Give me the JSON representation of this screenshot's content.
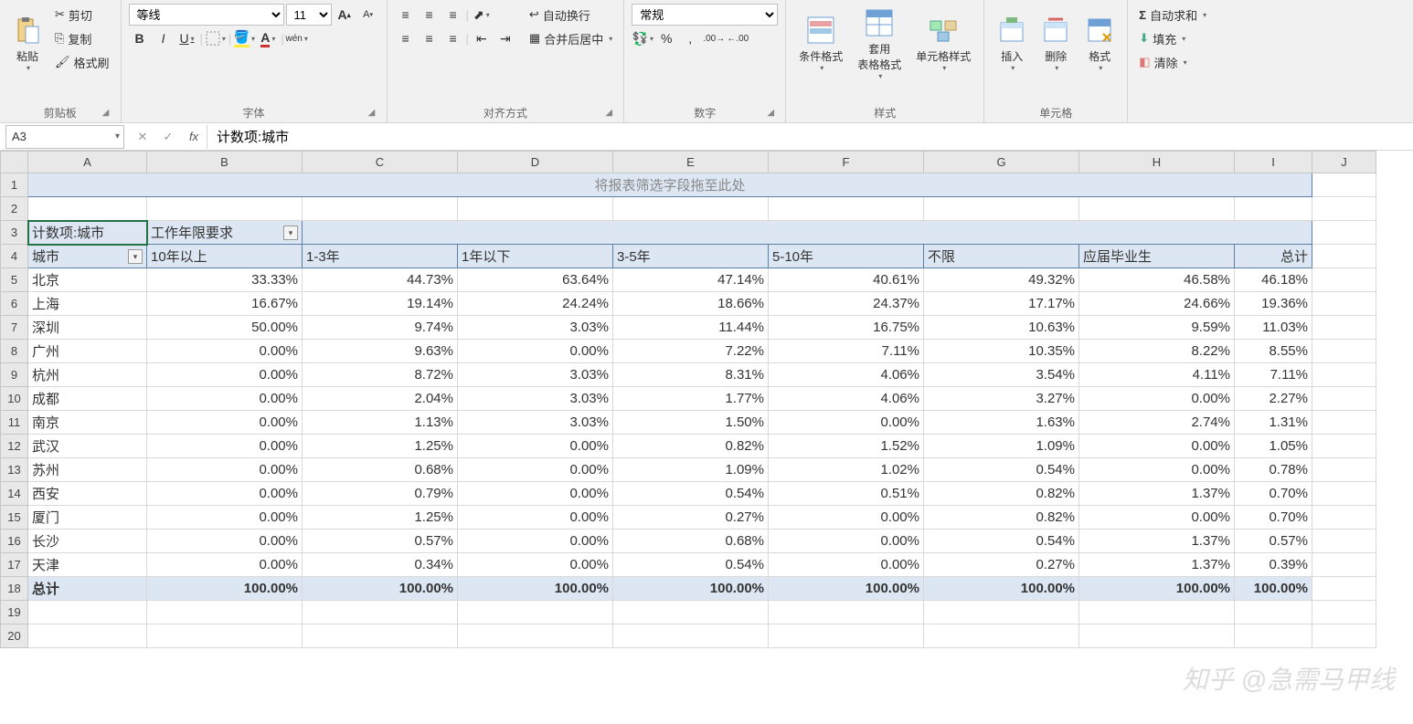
{
  "ribbon": {
    "clipboard": {
      "label": "剪贴板",
      "paste": "粘贴",
      "cut": "剪切",
      "copy": "复制",
      "format_painter": "格式刷"
    },
    "font": {
      "label": "字体",
      "name": "等线",
      "size": "11",
      "bold": "B",
      "italic": "I",
      "underline": "U",
      "pinyin": "wén"
    },
    "align": {
      "label": "对齐方式",
      "wrap": "自动换行",
      "merge": "合并后居中"
    },
    "number": {
      "label": "数字",
      "format": "常规"
    },
    "styles": {
      "label": "样式",
      "conditional": "条件格式",
      "table": "套用\n表格格式",
      "cell": "单元格样式"
    },
    "cells": {
      "label": "单元格",
      "insert": "插入",
      "delete": "删除",
      "format": "格式"
    },
    "editing": {
      "autosum": "自动求和",
      "fill": "填充",
      "clear": "清除"
    }
  },
  "formula_bar": {
    "cell_ref": "A3",
    "formula": "计数项:城市"
  },
  "columns": [
    "A",
    "B",
    "C",
    "D",
    "E",
    "F",
    "G",
    "H",
    "I",
    "J"
  ],
  "pivot": {
    "placeholder": "将报表筛选字段拖至此处",
    "value_field": "计数项:城市",
    "col_field": "工作年限要求",
    "row_field": "城市",
    "col_headers": [
      "10年以上",
      "1-3年",
      "1年以下",
      "3-5年",
      "5-10年",
      "不限",
      "应届毕业生",
      "总计"
    ],
    "rows": [
      {
        "label": "北京",
        "v": [
          "33.33%",
          "44.73%",
          "63.64%",
          "47.14%",
          "40.61%",
          "49.32%",
          "46.58%",
          "46.18%"
        ]
      },
      {
        "label": "上海",
        "v": [
          "16.67%",
          "19.14%",
          "24.24%",
          "18.66%",
          "24.37%",
          "17.17%",
          "24.66%",
          "19.36%"
        ]
      },
      {
        "label": "深圳",
        "v": [
          "50.00%",
          "9.74%",
          "3.03%",
          "11.44%",
          "16.75%",
          "10.63%",
          "9.59%",
          "11.03%"
        ]
      },
      {
        "label": "广州",
        "v": [
          "0.00%",
          "9.63%",
          "0.00%",
          "7.22%",
          "7.11%",
          "10.35%",
          "8.22%",
          "8.55%"
        ]
      },
      {
        "label": "杭州",
        "v": [
          "0.00%",
          "8.72%",
          "3.03%",
          "8.31%",
          "4.06%",
          "3.54%",
          "4.11%",
          "7.11%"
        ]
      },
      {
        "label": "成都",
        "v": [
          "0.00%",
          "2.04%",
          "3.03%",
          "1.77%",
          "4.06%",
          "3.27%",
          "0.00%",
          "2.27%"
        ]
      },
      {
        "label": "南京",
        "v": [
          "0.00%",
          "1.13%",
          "3.03%",
          "1.50%",
          "0.00%",
          "1.63%",
          "2.74%",
          "1.31%"
        ]
      },
      {
        "label": "武汉",
        "v": [
          "0.00%",
          "1.25%",
          "0.00%",
          "0.82%",
          "1.52%",
          "1.09%",
          "0.00%",
          "1.05%"
        ]
      },
      {
        "label": "苏州",
        "v": [
          "0.00%",
          "0.68%",
          "0.00%",
          "1.09%",
          "1.02%",
          "0.54%",
          "0.00%",
          "0.78%"
        ]
      },
      {
        "label": "西安",
        "v": [
          "0.00%",
          "0.79%",
          "0.00%",
          "0.54%",
          "0.51%",
          "0.82%",
          "1.37%",
          "0.70%"
        ]
      },
      {
        "label": "厦门",
        "v": [
          "0.00%",
          "1.25%",
          "0.00%",
          "0.27%",
          "0.00%",
          "0.82%",
          "0.00%",
          "0.70%"
        ]
      },
      {
        "label": "长沙",
        "v": [
          "0.00%",
          "0.57%",
          "0.00%",
          "0.68%",
          "0.00%",
          "0.54%",
          "1.37%",
          "0.57%"
        ]
      },
      {
        "label": "天津",
        "v": [
          "0.00%",
          "0.34%",
          "0.00%",
          "0.54%",
          "0.00%",
          "0.27%",
          "1.37%",
          "0.39%"
        ]
      }
    ],
    "total_label": "总计",
    "total_values": [
      "100.00%",
      "100.00%",
      "100.00%",
      "100.00%",
      "100.00%",
      "100.00%",
      "100.00%",
      "100.00%"
    ]
  },
  "watermark": "知乎 @急需马甲线",
  "chart_data": {
    "type": "table",
    "title": "计数项:城市 按 工作年限要求",
    "row_dimension": "城市",
    "col_dimension": "工作年限要求",
    "columns": [
      "10年以上",
      "1-3年",
      "1年以下",
      "3-5年",
      "5-10年",
      "不限",
      "应届毕业生",
      "总计"
    ],
    "rows": [
      "北京",
      "上海",
      "深圳",
      "广州",
      "杭州",
      "成都",
      "南京",
      "武汉",
      "苏州",
      "西安",
      "厦门",
      "长沙",
      "天津",
      "总计"
    ],
    "values_percent": [
      [
        33.33,
        44.73,
        63.64,
        47.14,
        40.61,
        49.32,
        46.58,
        46.18
      ],
      [
        16.67,
        19.14,
        24.24,
        18.66,
        24.37,
        17.17,
        24.66,
        19.36
      ],
      [
        50.0,
        9.74,
        3.03,
        11.44,
        16.75,
        10.63,
        9.59,
        11.03
      ],
      [
        0.0,
        9.63,
        0.0,
        7.22,
        7.11,
        10.35,
        8.22,
        8.55
      ],
      [
        0.0,
        8.72,
        3.03,
        8.31,
        4.06,
        3.54,
        4.11,
        7.11
      ],
      [
        0.0,
        2.04,
        3.03,
        1.77,
        4.06,
        3.27,
        0.0,
        2.27
      ],
      [
        0.0,
        1.13,
        3.03,
        1.5,
        0.0,
        1.63,
        2.74,
        1.31
      ],
      [
        0.0,
        1.25,
        0.0,
        0.82,
        1.52,
        1.09,
        0.0,
        1.05
      ],
      [
        0.0,
        0.68,
        0.0,
        1.09,
        1.02,
        0.54,
        0.0,
        0.78
      ],
      [
        0.0,
        0.79,
        0.0,
        0.54,
        0.51,
        0.82,
        1.37,
        0.7
      ],
      [
        0.0,
        1.25,
        0.0,
        0.27,
        0.0,
        0.82,
        0.0,
        0.7
      ],
      [
        0.0,
        0.57,
        0.0,
        0.68,
        0.0,
        0.54,
        1.37,
        0.57
      ],
      [
        0.0,
        0.34,
        0.0,
        0.54,
        0.0,
        0.27,
        1.37,
        0.39
      ],
      [
        100.0,
        100.0,
        100.0,
        100.0,
        100.0,
        100.0,
        100.0,
        100.0
      ]
    ]
  }
}
